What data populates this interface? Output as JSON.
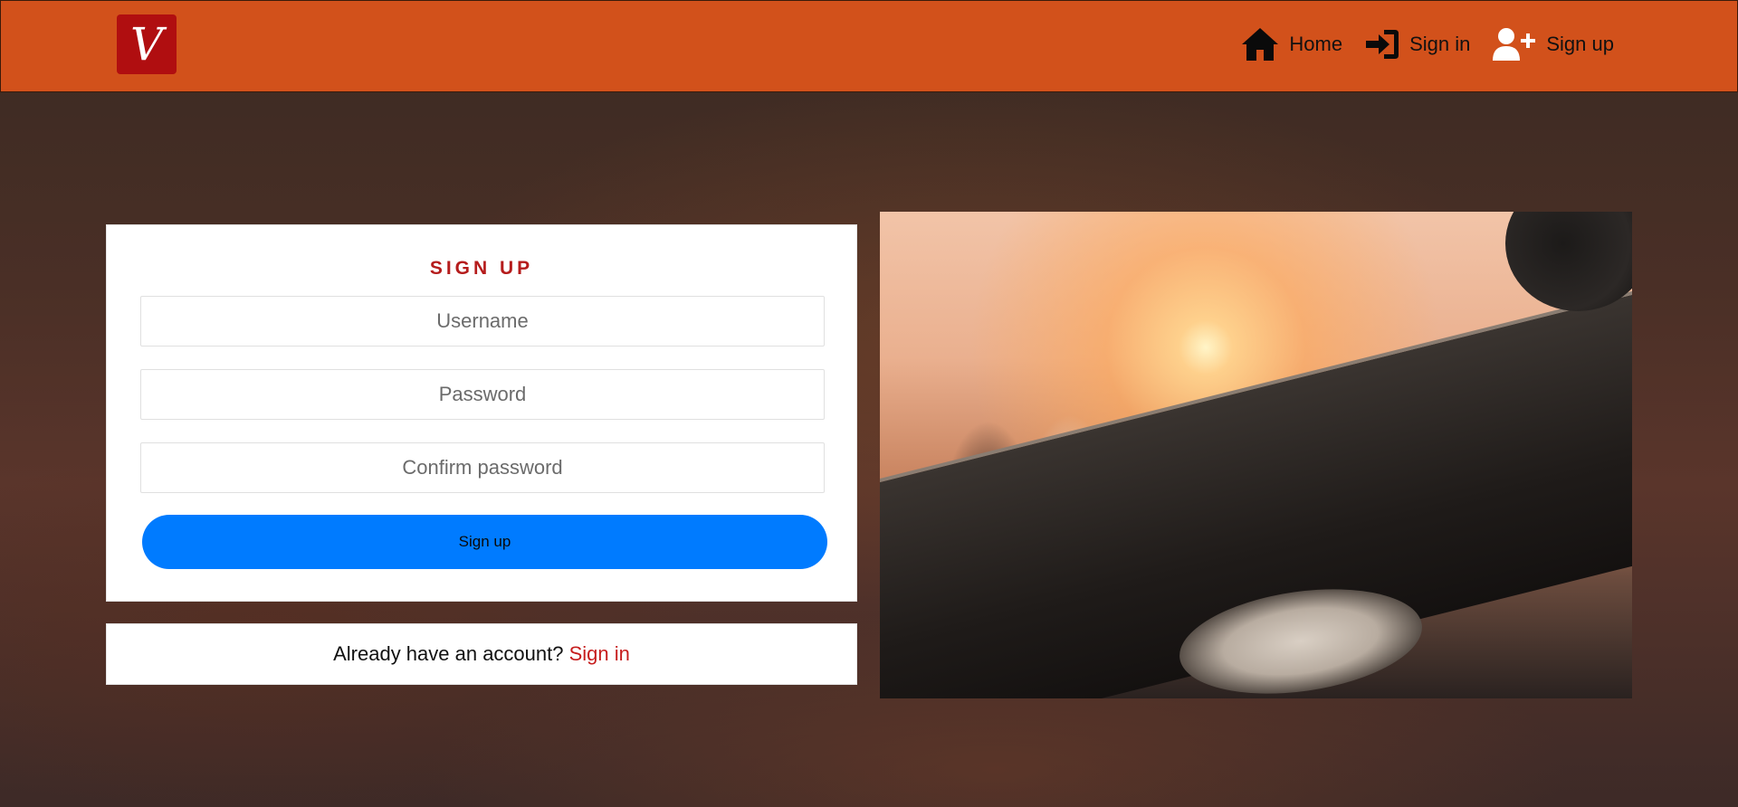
{
  "navbar": {
    "logo_text": "V",
    "links": [
      {
        "label": "Home",
        "icon": "home-icon"
      },
      {
        "label": "Sign in",
        "icon": "sign-in-icon"
      },
      {
        "label": "Sign up",
        "icon": "user-plus-icon"
      }
    ],
    "background_color": "#d2511b"
  },
  "signup_form": {
    "title": "SIGN UP",
    "username_placeholder": "Username",
    "password_placeholder": "Password",
    "confirm_password_placeholder": "Confirm password",
    "submit_label": "Sign up",
    "accent_color": "#007bff"
  },
  "account_prompt": {
    "text": "Already have an account?",
    "link_label": "Sign in"
  },
  "hero_image": {
    "icon": "dj-party-photo"
  }
}
